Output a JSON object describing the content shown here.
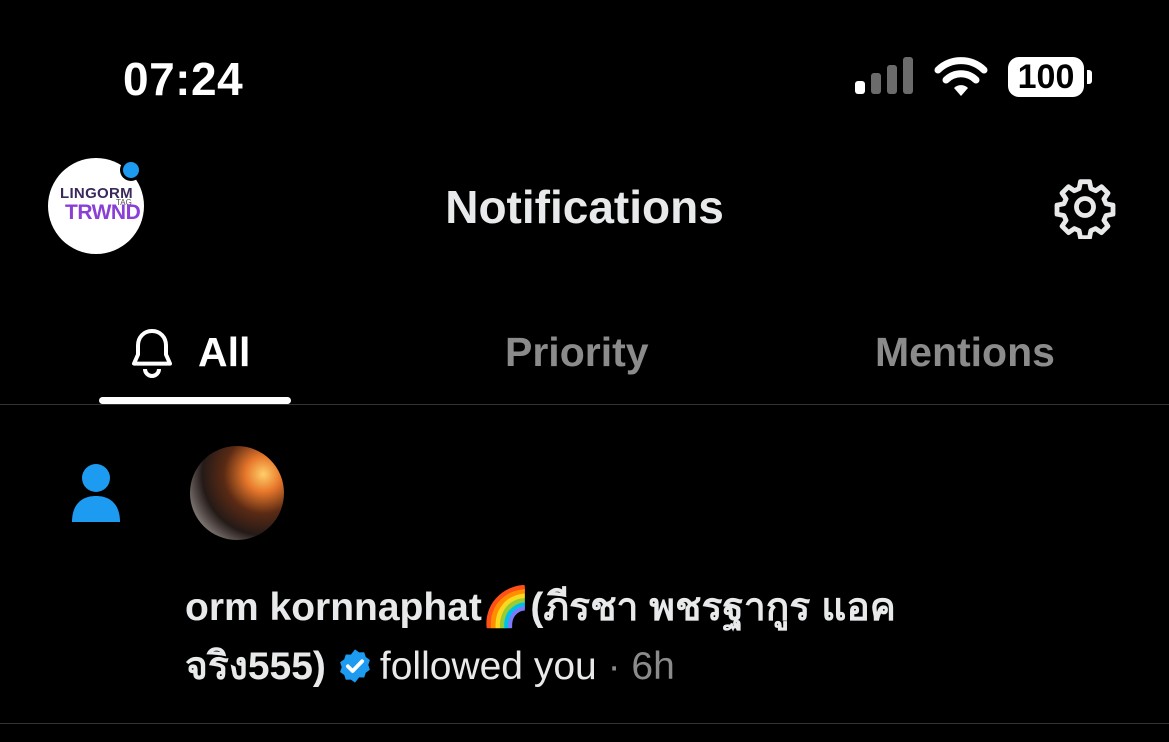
{
  "status_bar": {
    "time": "07:24",
    "battery": "100"
  },
  "header": {
    "title": "Notifications",
    "logo_line1": "LINGORM",
    "logo_line2": "TRWND",
    "logo_tag": "TAG"
  },
  "tabs": [
    {
      "label": "All",
      "active": true
    },
    {
      "label": "Priority",
      "active": false
    },
    {
      "label": "Mentions",
      "active": false
    }
  ],
  "notifications": [
    {
      "type": "follow",
      "name": "orm kornnaphat🌈(ภีรชา พชรฐากูร แอคจริง555)",
      "action": "followed you",
      "separator": "·",
      "time": "6h"
    }
  ],
  "colors": {
    "accent": "#1d9bf0",
    "background": "#000000",
    "muted": "#8b8b8b"
  },
  "icons": [
    "signal-icon",
    "wifi-icon",
    "settings-gear-icon",
    "bell-icon",
    "person-icon",
    "verified-badge-icon"
  ]
}
